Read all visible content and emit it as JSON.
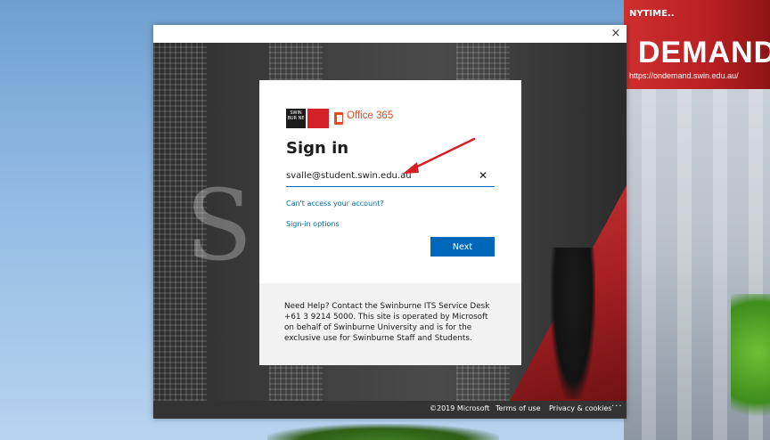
{
  "window": {
    "close_label": "×"
  },
  "wallpaper": {
    "banner_small": "NYTIME..",
    "banner_big": "DEMAND",
    "banner_url": "https://ondemand.swin.edu.au/"
  },
  "signin": {
    "logo_swin": "SWIN BUR NE",
    "brand": "Office 365",
    "title": "Sign in",
    "email_value": "svalle@student.swin.edu.au",
    "clear_label": "✕",
    "cant_access": "Can't access your account?",
    "signin_options": "Sign-in options",
    "next_label": "Next",
    "help_text": "Need Help? Contact the Swinburne ITS Service Desk +61 3 9214 5000. This site is operated by Microsoft on behalf of Swinburne University and is for the exclusive use for Swinburne Staff and Students."
  },
  "footer": {
    "copyright": "©2019 Microsoft",
    "terms": "Terms of use",
    "privacy": "Privacy & cookies",
    "more": "···"
  },
  "colors": {
    "accent": "#0067b8",
    "brand_orange": "#e54b1f",
    "annotation_red": "#d42026"
  }
}
